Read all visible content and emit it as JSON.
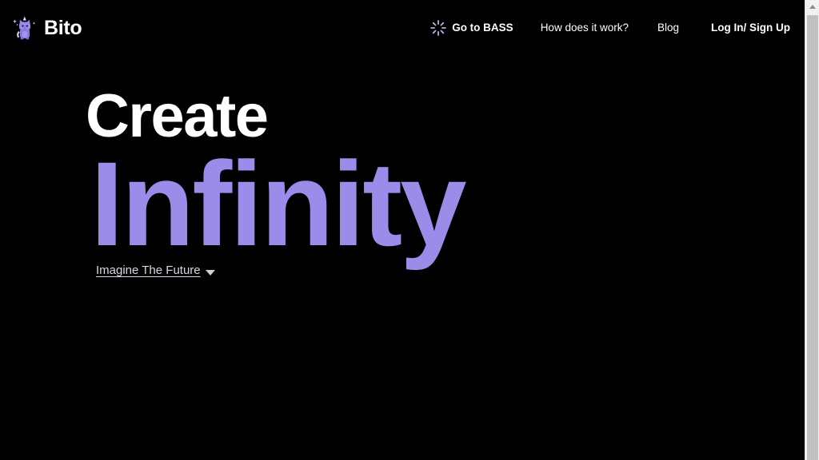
{
  "theme": {
    "background": "#000000",
    "accent_purple": "#9a8ce8",
    "text_primary": "#ffffff",
    "text_muted": "#d8d8e0",
    "scrollbar_track": "#f1f1f1",
    "scrollbar_thumb": "#c1c1c1"
  },
  "header": {
    "brand": {
      "name": "Bito",
      "logo_icon": "unicorn-cat-logo-icon"
    },
    "nav": [
      {
        "label": "Go to BASS",
        "icon": "sparkle-burst-icon",
        "bold": true
      },
      {
        "label": "How does it work?",
        "icon": "",
        "bold": false
      },
      {
        "label": "Blog",
        "icon": "",
        "bold": false
      },
      {
        "label": "Log In/ Sign Up",
        "icon": "",
        "bold": true
      }
    ]
  },
  "hero": {
    "line1": "Create",
    "line2": "Infinity",
    "subtitle": "Imagine The Future",
    "subtitle_icon": "chevron-down-icon"
  },
  "scrollbar": {
    "up_arrow_icon": "scroll-up-arrow-icon",
    "thumb_icon": "scrollbar-thumb"
  }
}
